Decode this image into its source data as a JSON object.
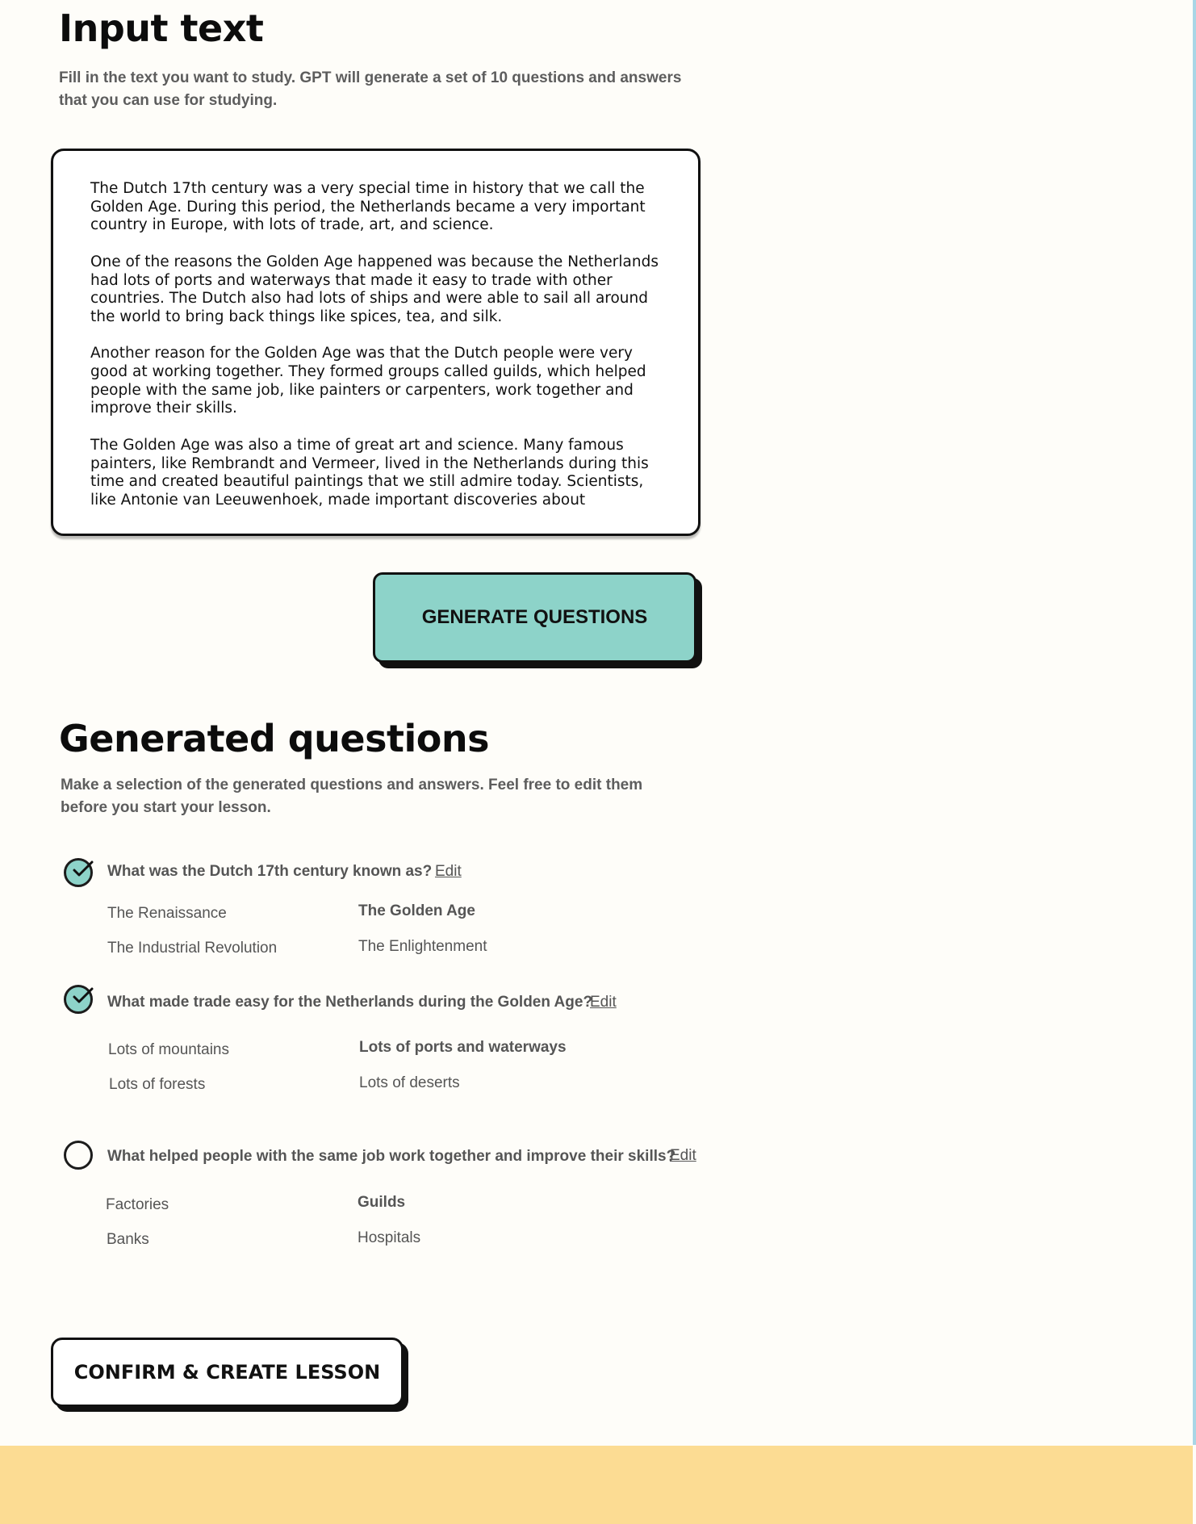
{
  "input_section": {
    "title": "Input text",
    "description": "Fill in the text you want to study. GPT will generate a set of 10 questions and answers that you can use for studying.",
    "text_paragraphs": [
      "The Dutch 17th century was a very special time in history that we call the\nGolden Age. During this period, the Netherlands became a very important\ncountry in Europe, with lots of trade, art, and science.",
      "One of the reasons the Golden Age happened was because the Netherlands\nhad lots of ports and waterways that made it easy to trade with other\ncountries. The Dutch also had lots of ships and were able to sail all around\nthe world to bring back things like spices, tea, and silk.",
      "Another reason for the Golden Age was that the Dutch people were very\ngood at working together. They formed groups called guilds, which helped\npeople with the same job, like painters or carpenters, work together and\nimprove their skills.",
      "The Golden Age was also a time of great art and science. Many famous\npainters, like Rembrandt and Vermeer, lived in the Netherlands during this\ntime and created beautiful paintings that we still admire today. Scientists,\nlike Antonie van Leeuwenhoek, made important discoveries about"
    ],
    "generate_button": "GENERATE QUESTIONS"
  },
  "generated_section": {
    "title": "Generated questions",
    "description": "Make a selection of the generated questions and answers. Feel free to edit them before you start your lesson.",
    "edit_label": "Edit",
    "questions": [
      {
        "selected": true,
        "question": "What was the Dutch 17th century known as?",
        "answers": [
          "The Renaissance",
          "The Golden Age",
          "The Industrial Revolution",
          "The Enlightenment"
        ],
        "correct_index": 1
      },
      {
        "selected": true,
        "question": "What made trade easy for the Netherlands during the Golden Age?",
        "answers": [
          "Lots of mountains",
          "Lots of ports and waterways",
          "Lots of forests",
          "Lots of deserts"
        ],
        "correct_index": 1
      },
      {
        "selected": false,
        "question": "What helped people with the same job work together and improve their skills?",
        "answers": [
          "Factories",
          "Guilds",
          "Banks",
          "Hospitals"
        ],
        "correct_index": 1
      }
    ],
    "confirm_button": "CONFIRM & CREATE LESSON"
  },
  "colors": {
    "page_background": "#fefdf9",
    "accent_teal": "#8dd3c9",
    "footer_band": "#fcdc93",
    "muted_text": "#555555"
  }
}
